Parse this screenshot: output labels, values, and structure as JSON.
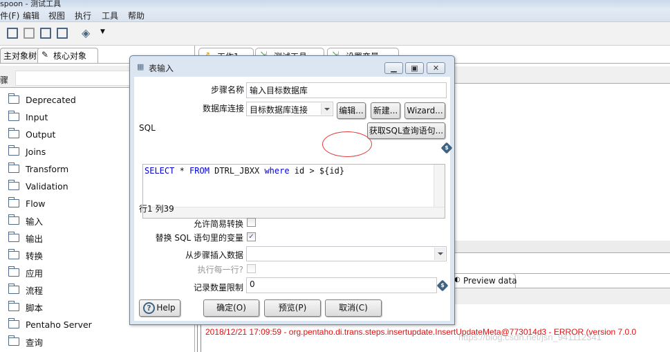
{
  "window": {
    "title": "spoon - 测试工具"
  },
  "menu": [
    "件(F)",
    "编辑",
    "视图",
    "执行",
    "工具",
    "帮助"
  ],
  "toolbar": {
    "icons": [
      "open-file-icon",
      "explore-icon",
      "save-icon",
      "save-as-icon",
      "layers-icon"
    ]
  },
  "left_panel": {
    "tabs": [
      "主对象树",
      "核心对象"
    ],
    "search_label": "骤",
    "search_value": "",
    "tree": [
      "Deprecated",
      "Input",
      "Output",
      "Joins",
      "Transform",
      "Validation",
      "Flow",
      "输入",
      "输出",
      "转换",
      "应用",
      "流程",
      "脚本",
      "Pentaho Server",
      "查询"
    ]
  },
  "editor_tabs": [
    "工作1",
    "测试工具",
    "设置变量"
  ],
  "bottom": {
    "preview_tab": "Preview data",
    "log_line": "2018/12/21 17:09:59 - org.pentaho.di.trans.steps.insertupdate.InsertUpdateMeta@773014d3 - ERROR (version 7.0.0",
    "watermark": "https://blog.csdn.net/jsn_941112341"
  },
  "dialog": {
    "title": "表输入",
    "step_name_label": "步骤名称",
    "step_name_value": "输入目标数据库",
    "db_conn_label": "数据库连接",
    "db_conn_value": "目标数据库连接",
    "edit_btn": "编辑...",
    "new_btn": "新建...",
    "wizard_btn": "Wizard...",
    "sql_label": "SQL",
    "get_sql_btn": "获取SQL查询语句...",
    "sql": {
      "kw1": "SELECT",
      "t1": " * ",
      "kw2": "FROM",
      "t2": " DTRL_JBXX ",
      "kw3": "where",
      "t3": " id > ",
      "var": "${id}"
    },
    "cursor_pos": "行1 列39",
    "lazy_conv_label": "允许简易转换",
    "lazy_conv_checked": false,
    "replace_vars_label": "替换 SQL 语句里的变量",
    "replace_vars_checked": true,
    "insert_from_label": "从步骤插入数据",
    "insert_from_value": "",
    "exec_each_label": "执行每一行?",
    "exec_each_checked": false,
    "limit_label": "记录数量限制",
    "limit_value": "0",
    "help_btn": "Help",
    "ok_btn": "确定(O)",
    "preview_btn": "预览(P)",
    "cancel_btn": "取消(C)",
    "annotation_color": "#e23b3b"
  }
}
